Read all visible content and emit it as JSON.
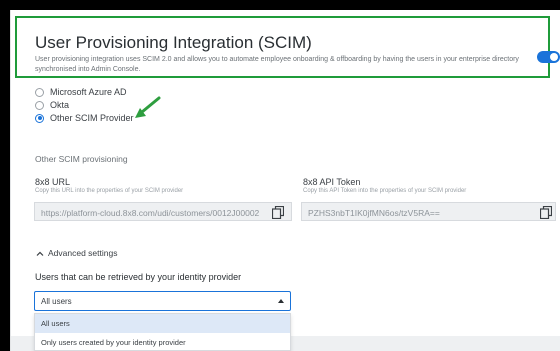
{
  "header": {
    "title": "User Provisioning Integration (SCIM)",
    "description": "User provisioning integration uses SCIM 2.0 and allows you to automate employee onboarding & offboarding by having the users in your enterprise directory synchronised into Admin Console.",
    "toggle_on": true
  },
  "providers": {
    "options": [
      "Microsoft Azure AD",
      "Okta",
      "Other SCIM Provider"
    ],
    "selected": "Other SCIM Provider"
  },
  "other_scim": {
    "section_label": "Other SCIM provisioning",
    "url": {
      "label": "8x8 URL",
      "hint": "Copy this URL into the properties of your SCIM provider",
      "value": "https://platform-cloud.8x8.com/udi/customers/0012J00002"
    },
    "token": {
      "label": "8x8 API Token",
      "hint": "Copy this API Token into the properties of your SCIM provider",
      "value": "PZHS3nbT1IK0jfMN6os/tzV5RA=="
    }
  },
  "advanced": {
    "label": "Advanced settings",
    "users_label": "Users that can be retrieved by your identity provider",
    "selected": "All users",
    "options": [
      "All users",
      "Only users created by your identity provider"
    ]
  },
  "colors": {
    "accent": "#1a73d9",
    "highlight_border": "#1f9b3a",
    "annotation_arrow": "#2e9e3f"
  }
}
